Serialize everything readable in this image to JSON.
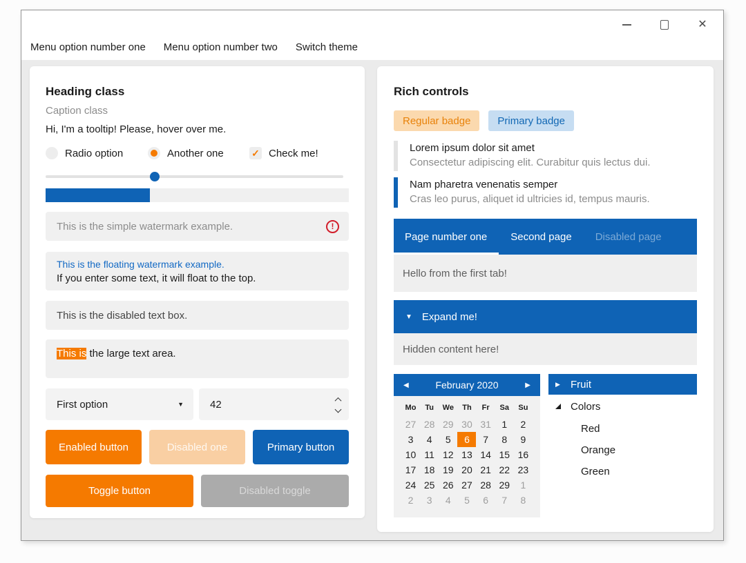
{
  "window": {
    "controls": {
      "minimize": "minimize",
      "maximize": "maximize",
      "close_glyph": "✕"
    }
  },
  "menu": {
    "items": [
      "Menu option number one",
      "Menu option number two",
      "Switch theme"
    ]
  },
  "icons": {
    "check": "✓",
    "combo_arrow": "▼",
    "expander_arrow": "▼",
    "calendar_prev": "◀",
    "calendar_next": "▶",
    "tree_collapsed": "▶",
    "error_mark": "!"
  },
  "left_panel": {
    "heading": "Heading class",
    "caption": "Caption class",
    "tooltip_text": "Hi, I'm a tooltip! Please, hover over me.",
    "radio_unselected_label": "Radio option",
    "radio_selected_label": "Another one",
    "checkbox_label": "Check me!",
    "slider_percent": 36,
    "progress_percent": 34.5,
    "watermark_simple": "This is the simple watermark example.",
    "watermark_floating_label": "This is the floating watermark example.",
    "watermark_floating_text": "If you enter some text, it will float to the top.",
    "disabled_textbox": "This is the disabled text box.",
    "textarea_highlight": "This is",
    "textarea_rest": " the large text area.",
    "combo_value": "First option",
    "numeric_value": "42",
    "buttons": {
      "enabled": "Enabled button",
      "disabled": "Disabled one",
      "primary": "Primary button",
      "toggle": "Toggle button",
      "toggle_disabled": "Disabled toggle"
    }
  },
  "right_panel": {
    "heading": "Rich controls",
    "badges": [
      {
        "label": "Regular badge",
        "type": "regular"
      },
      {
        "label": "Primary badge",
        "type": "primary"
      }
    ],
    "list": [
      {
        "title": "Lorem ipsum dolor sit amet",
        "subtitle": "Consectetur adipiscing elit. Curabitur quis lectus dui.",
        "selected": false
      },
      {
        "title": "Nam pharetra venenatis semper",
        "subtitle": "Cras leo purus, aliquet id ultricies id, tempus mauris.",
        "selected": true
      }
    ],
    "tabs": {
      "items": [
        {
          "label": "Page number one",
          "state": "active"
        },
        {
          "label": "Second page",
          "state": "normal"
        },
        {
          "label": "Disabled page",
          "state": "disabled"
        }
      ],
      "content": "Hello from the first tab!"
    },
    "expander": {
      "header": "Expand me!",
      "content": "Hidden content here!"
    },
    "calendar": {
      "title": "February 2020",
      "day_names": [
        "Mo",
        "Tu",
        "We",
        "Th",
        "Fr",
        "Sa",
        "Su"
      ],
      "weeks": [
        [
          {
            "d": "27",
            "muted": true
          },
          {
            "d": "28",
            "muted": true
          },
          {
            "d": "29",
            "muted": true
          },
          {
            "d": "30",
            "muted": true
          },
          {
            "d": "31",
            "muted": true
          },
          {
            "d": "1"
          },
          {
            "d": "2"
          }
        ],
        [
          {
            "d": "3"
          },
          {
            "d": "4"
          },
          {
            "d": "5"
          },
          {
            "d": "6",
            "selected": true
          },
          {
            "d": "7"
          },
          {
            "d": "8"
          },
          {
            "d": "9"
          }
        ],
        [
          {
            "d": "10"
          },
          {
            "d": "11"
          },
          {
            "d": "12"
          },
          {
            "d": "13"
          },
          {
            "d": "14"
          },
          {
            "d": "15"
          },
          {
            "d": "16"
          }
        ],
        [
          {
            "d": "17"
          },
          {
            "d": "18"
          },
          {
            "d": "19"
          },
          {
            "d": "20"
          },
          {
            "d": "21"
          },
          {
            "d": "22"
          },
          {
            "d": "23"
          }
        ],
        [
          {
            "d": "24"
          },
          {
            "d": "25"
          },
          {
            "d": "26"
          },
          {
            "d": "27"
          },
          {
            "d": "28"
          },
          {
            "d": "29"
          },
          {
            "d": "1",
            "muted": true
          }
        ],
        [
          {
            "d": "2",
            "muted": true
          },
          {
            "d": "3",
            "muted": true
          },
          {
            "d": "4",
            "muted": true
          },
          {
            "d": "5",
            "muted": true
          },
          {
            "d": "6",
            "muted": true
          },
          {
            "d": "7",
            "muted": true
          },
          {
            "d": "8",
            "muted": true
          }
        ]
      ]
    },
    "tree": {
      "items": [
        {
          "label": "Fruit",
          "level": 0,
          "expanded": false,
          "selected": true
        },
        {
          "label": "Colors",
          "level": 0,
          "expanded": true,
          "selected": false
        },
        {
          "label": "Red",
          "level": 1
        },
        {
          "label": "Orange",
          "level": 1
        },
        {
          "label": "Green",
          "level": 1
        }
      ]
    }
  },
  "colors": {
    "accent_orange": "#f57a00",
    "accent_blue": "#0f63b5",
    "badge_orange_bg": "#fbd9ae",
    "badge_orange_text": "#e8820a",
    "badge_blue_bg": "#c6ddf2",
    "badge_blue_text": "#1268b4",
    "error_red": "#d21e2b",
    "page_bg": "#ebebeb",
    "input_bg": "#f0f0f0",
    "muted_text": "#8c8c8c"
  }
}
